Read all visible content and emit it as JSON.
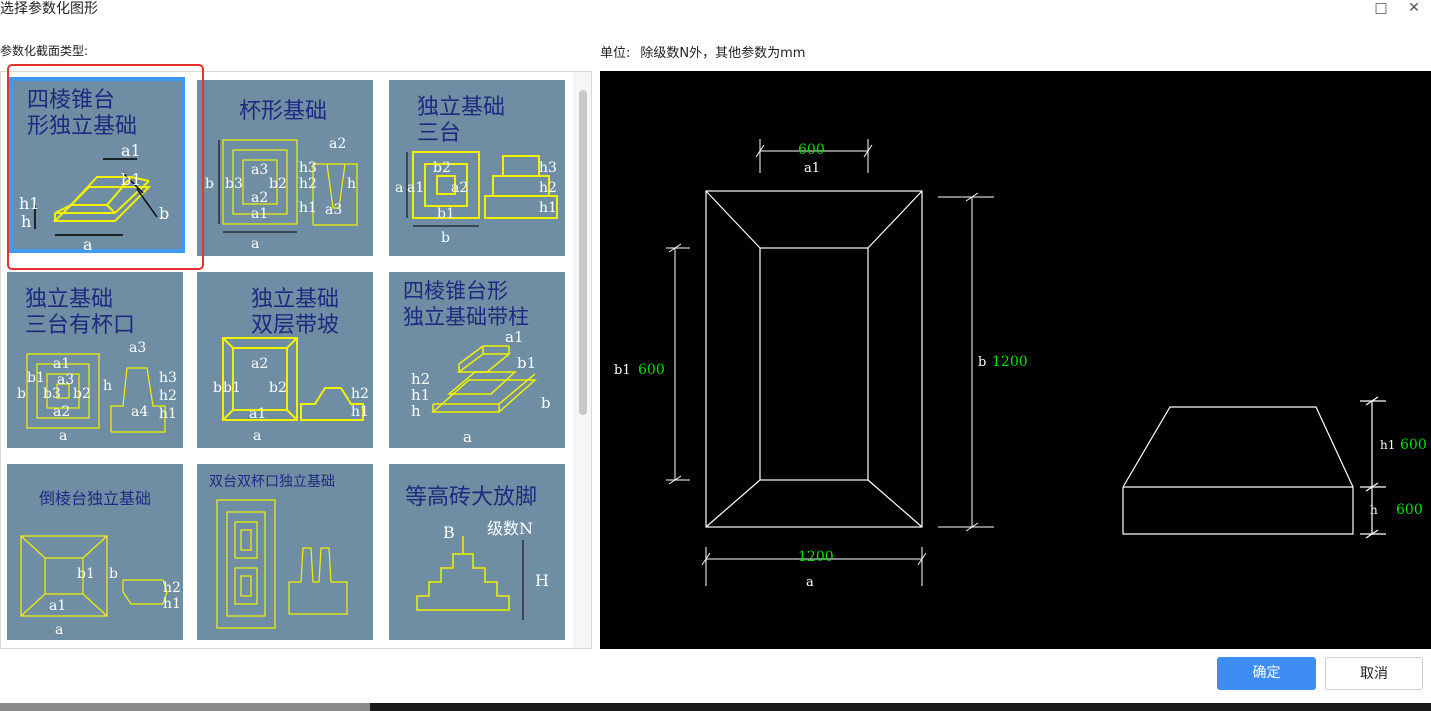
{
  "window": {
    "title": "选择参数化图形",
    "maximize_icon": "□",
    "close_icon": "✕"
  },
  "labels": {
    "section_type": "参数化截面类型:",
    "units_label": "单位:",
    "units_value": "除级数N外，其他参数为mm"
  },
  "tiles": [
    {
      "title_line1": "四棱锥台",
      "title_line2": "形独立基础",
      "selected": true
    },
    {
      "title_line1": "杯形基础",
      "title_line2": ""
    },
    {
      "title_line1": "独立基础",
      "title_line2": "三台"
    },
    {
      "title_line1": "独立基础",
      "title_line2": "三台有杯口"
    },
    {
      "title_line1": "独立基础",
      "title_line2": "双层带坡"
    },
    {
      "title_line1": "四棱锥台形",
      "title_line2": "独立基础带柱"
    },
    {
      "title_line1": "倒棱台独立基础",
      "title_line2": ""
    },
    {
      "title_line1": "双台双杯口独立基础",
      "title_line2": ""
    },
    {
      "title_line1": "等高砖大放脚",
      "title_line2": ""
    }
  ],
  "tile_labels": {
    "a": "a",
    "a1": "a1",
    "b": "b",
    "b1": "b1",
    "h": "h",
    "h1": "h1",
    "a2": "a2",
    "a3": "a3",
    "b2": "b2",
    "b3": "b3",
    "h2": "h2",
    "h3": "h3",
    "a4": "a4",
    "B": "B",
    "H": "H",
    "level_n": "级数N"
  },
  "preview": {
    "a1_value": "600",
    "a1_label": "a1",
    "b1_label": "b1",
    "b1_value": "600",
    "b_label": "b",
    "b_value": "1200",
    "a_value": "1200",
    "a_label": "a",
    "h1_label": "h1",
    "h1_value": "600",
    "h_label": "h",
    "h_value": "600"
  },
  "buttons": {
    "ok": "确定",
    "cancel": "取消"
  },
  "colors": {
    "tile_bg": "#6f8ea3",
    "tile_title": "#1e2a80",
    "tile_line": "#f2f200",
    "tile_dim": "#ffffff",
    "selection_red": "#e83030",
    "selection_blue": "#3e9bf0",
    "preview_bg": "#000000",
    "preview_value": "#00e000",
    "ok_blue": "#3e8df3"
  }
}
